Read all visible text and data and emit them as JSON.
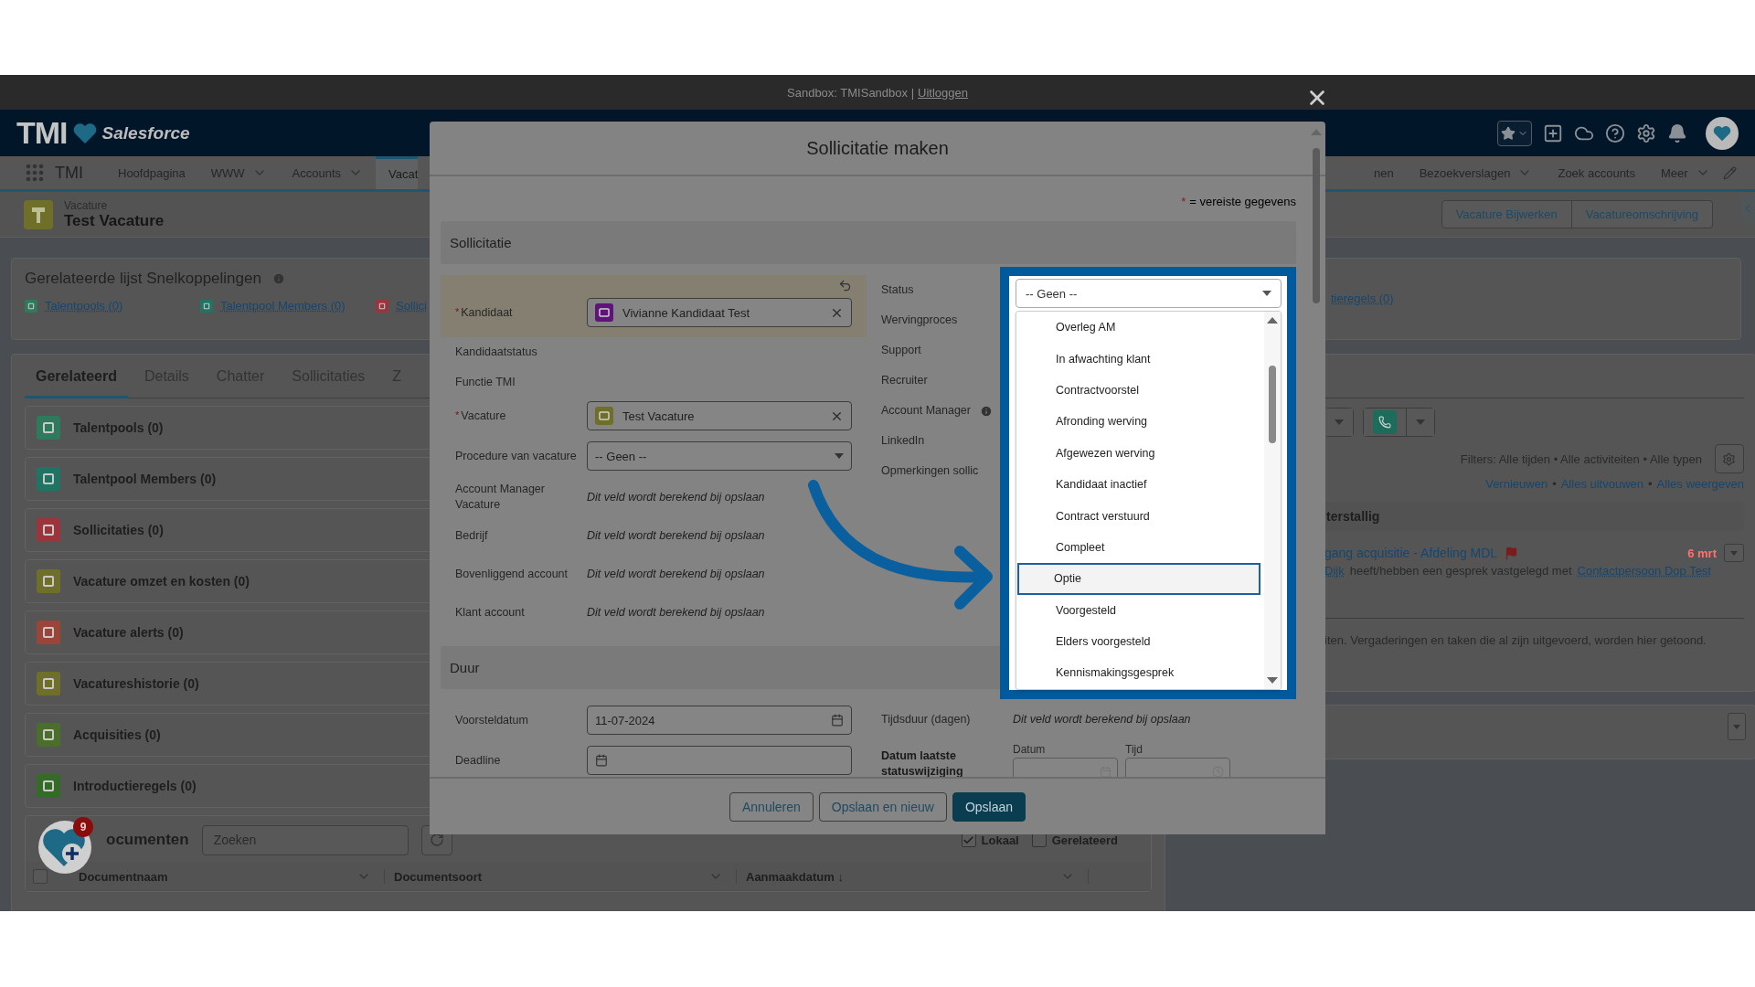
{
  "sandbox_bar": {
    "text": "Sandbox: TMISandbox |",
    "link": "Uitloggen"
  },
  "header": {
    "logo": "TMI",
    "brand": "Salesforce"
  },
  "nav": {
    "app_name": "TMI",
    "items": [
      {
        "label": "Hoofdpagina",
        "menu": false,
        "selected": false
      },
      {
        "label": "WWW",
        "menu": true,
        "selected": false
      },
      {
        "label": "Accounts",
        "menu": true,
        "selected": false
      },
      {
        "label": "Vacat",
        "menu": false,
        "selected": true
      }
    ],
    "items_right": [
      {
        "label": "nen",
        "menu": false,
        "selected": false
      },
      {
        "label": "Bezoekverslagen",
        "menu": true,
        "selected": false
      },
      {
        "label": "Zoek accounts",
        "menu": false,
        "selected": false
      },
      {
        "label": "Meer",
        "menu": true,
        "selected": false
      }
    ]
  },
  "record": {
    "object": "Vacature",
    "title": "Test Vacature",
    "actions": [
      "Vacature Bijwerken",
      "Vacatureomschrijving"
    ]
  },
  "quick_links": {
    "title": "Gerelateerde lijst Snelkoppelingen",
    "links": [
      {
        "label": "Talentpools (0)",
        "color": "#2d7a5c"
      },
      {
        "label": "Talentpool Members (0)",
        "color": "#1f7463"
      },
      {
        "label": "Sollici",
        "color": "#9c353b"
      }
    ],
    "links_right": [
      "tieregels (0)"
    ]
  },
  "tabs": [
    {
      "label": "Gerelateerd",
      "selected": true
    },
    {
      "label": "Details",
      "selected": false
    },
    {
      "label": "Chatter",
      "selected": false
    },
    {
      "label": "Sollicitaties",
      "selected": false
    },
    {
      "label": "Z",
      "selected": false
    }
  ],
  "related_lists": [
    {
      "label": "Talentpools (0)",
      "color": "#2d7a5c"
    },
    {
      "label": "Talentpool Members (0)",
      "color": "#1f7463"
    },
    {
      "label": "Sollicitaties (0)",
      "color": "#9c353b"
    },
    {
      "label": "Vacature omzet en kosten (0)",
      "color": "#6f6f2a"
    },
    {
      "label": "Vacature alerts (0)",
      "color": "#9a4538"
    },
    {
      "label": "Vacatureshistorie (0)",
      "color": "#6f6f2a"
    },
    {
      "label": "Acquisities (0)",
      "color": "#4a6e2c"
    },
    {
      "label": "Introductieregels (0)",
      "color": "#336b27"
    }
  ],
  "documents": {
    "title": "ocumenten",
    "search_placeholder": "Zoeken",
    "filters": [
      {
        "label": "Lokaal",
        "checked": true
      },
      {
        "label": "Gerelateerd",
        "checked": false
      }
    ],
    "select_all": {
      "checked": false
    },
    "columns": [
      "Documentnaam",
      "Documentsoort",
      "Aanmaakdatum ↓"
    ]
  },
  "activity": {
    "filters": "Filters: Alle tijden • Alle activiteiten • Alle typen",
    "links": [
      "Vernieuwen",
      "Alles uitvouwen",
      "Alles weergeven"
    ],
    "separator": "•",
    "section": "terstallig",
    "item": {
      "title": "gang acquisitie - Afdeling MDL",
      "date": "6 mrt",
      "owner": "Dijk",
      "text": "heeft/hebben een gesprek vastgelegd met",
      "contact": "Contactpersoon Dop Test"
    },
    "empty_text": "iten. Vergaderingen en taken die al zijn uitgevoerd, worden hier getoond."
  },
  "float_button": {
    "badge": "9"
  },
  "modal": {
    "title": "Sollicitatie maken",
    "required_mark": "*",
    "required_note": "= vereiste gegevens",
    "sections": [
      {
        "title": "Sollicitatie",
        "left": [
          {
            "label": "Kandidaat",
            "kind": "lookup",
            "required": true,
            "changed": true,
            "value": "Vivianne Kandidaat Test",
            "color": "#5e1478"
          },
          {
            "label": "Kandidaatstatus",
            "kind": "empty",
            "required": false
          },
          {
            "label": "Functie TMI",
            "kind": "empty",
            "required": false
          },
          {
            "label": "Vacature",
            "kind": "lookup",
            "required": true,
            "changed": false,
            "value": "Test Vacature",
            "color": "#6f6f2a"
          },
          {
            "label": "Procedure van vacature",
            "kind": "select",
            "required": false,
            "value": "-- Geen --"
          },
          {
            "label": "Account Manager Vacature",
            "kind": "computed",
            "required": false,
            "value": "Dit veld wordt berekend bij opslaan"
          },
          {
            "label": "Bedrijf",
            "kind": "computed",
            "required": false,
            "value": "Dit veld wordt berekend bij opslaan"
          },
          {
            "label": "Bovenliggend account",
            "kind": "computed",
            "required": false,
            "value": "Dit veld wordt berekend bij opslaan"
          },
          {
            "label": "Klant account",
            "kind": "computed",
            "required": false,
            "value": "Dit veld wordt berekend bij opslaan"
          }
        ],
        "right": [
          {
            "label": "Status",
            "kind": "empty",
            "required": false
          },
          {
            "label": "Wervingproces",
            "kind": "empty",
            "required": false
          },
          {
            "label": "Support",
            "kind": "empty",
            "required": false
          },
          {
            "label": "Recruiter",
            "kind": "empty",
            "required": false
          },
          {
            "label": "Account Manager",
            "kind": "empty",
            "required": false,
            "info": true
          },
          {
            "label": "LinkedIn",
            "kind": "empty",
            "required": false
          },
          {
            "label": "Opmerkingen sollic",
            "kind": "empty",
            "required": false
          }
        ]
      },
      {
        "title": "Duur",
        "left": [
          {
            "label": "Voorsteldatum",
            "kind": "date",
            "required": false,
            "value": "11-07-2024"
          },
          {
            "label": "Deadline",
            "kind": "date",
            "required": false
          }
        ],
        "right": [
          {
            "label": "Tijdsduur (dagen)",
            "kind": "computed",
            "required": false,
            "value": "Dit veld wordt berekend bij opslaan"
          },
          {
            "label": "Datum laatste statuswijziging",
            "kind": "datetime",
            "required": false,
            "parts": [
              {
                "label": "Datum",
                "kind": "date"
              },
              {
                "label": "Tijd",
                "kind": "time"
              }
            ]
          }
        ]
      }
    ],
    "status_dropdown": {
      "value": "-- Geen --",
      "options": [
        {
          "label": "Overleg AM",
          "selected": false
        },
        {
          "label": "In afwachting klant",
          "selected": false
        },
        {
          "label": "Contractvoorstel",
          "selected": false
        },
        {
          "label": "Afronding werving",
          "selected": false
        },
        {
          "label": "Afgewezen werving",
          "selected": false
        },
        {
          "label": "Kandidaat inactief",
          "selected": false
        },
        {
          "label": "Contract verstuurd",
          "selected": false
        },
        {
          "label": "Compleet",
          "selected": false
        },
        {
          "label": "Optie",
          "selected": true
        },
        {
          "label": "Voorgesteld",
          "selected": false
        },
        {
          "label": "Elders voorgesteld",
          "selected": false
        },
        {
          "label": "Kennismakingsgesprek",
          "selected": false
        }
      ]
    },
    "buttons": [
      {
        "label": "Annuleren",
        "kind": "neutral"
      },
      {
        "label": "Opslaan en nieuw",
        "kind": "neutral"
      },
      {
        "label": "Opslaan",
        "kind": "brand"
      }
    ]
  }
}
